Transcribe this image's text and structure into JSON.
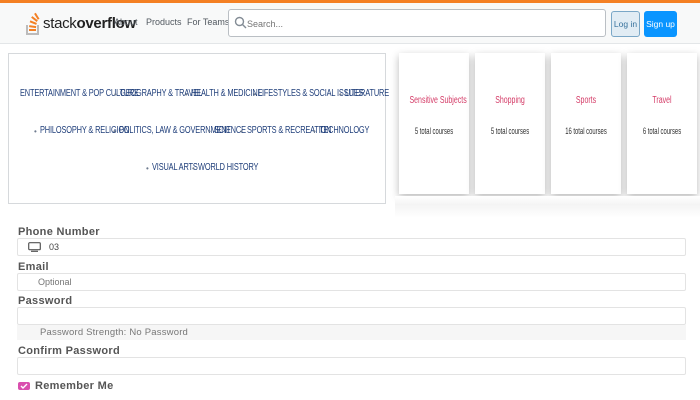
{
  "header": {
    "logo_text_light": "stack",
    "logo_text_bold": "overflow",
    "nav": [
      "About",
      "Products",
      "For Teams"
    ],
    "search_placeholder": "Search...",
    "login_label": "Log in",
    "signup_label": "Sign up",
    "accent_color": "#f48024"
  },
  "categories": [
    "ENTERTAINMENT & POP CULTURE",
    "GEOGRAPHY & TRAVEL",
    "HEALTH & MEDICINE",
    "LIFESTYLES & SOCIAL ISSUES",
    "LITERATURE",
    "PHILOSOPHY & RELIGION",
    "POLITICS, LAW & GOVERNMENT",
    "SCIENCE",
    "SPORTS & RECREATION",
    "TECHNOLOGY",
    "VISUAL ARTS",
    "WORLD HISTORY"
  ],
  "cards": [
    {
      "title": "Sensitive Subjects",
      "subtitle": "5 total courses"
    },
    {
      "title": "Shopping",
      "subtitle": "5 total courses"
    },
    {
      "title": "Sports",
      "subtitle": "16 total courses"
    },
    {
      "title": "Travel",
      "subtitle": "6 total courses"
    }
  ],
  "form": {
    "phone_label": "Phone Number",
    "phone_value": "03",
    "email_label": "Email",
    "email_placeholder": "Optional",
    "password_label": "Password",
    "password_strength": "Password Strength: No Password",
    "confirm_label": "Confirm Password",
    "remember_label": "Remember Me",
    "remember_checked": true,
    "checkbox_color": "#d94fae"
  }
}
